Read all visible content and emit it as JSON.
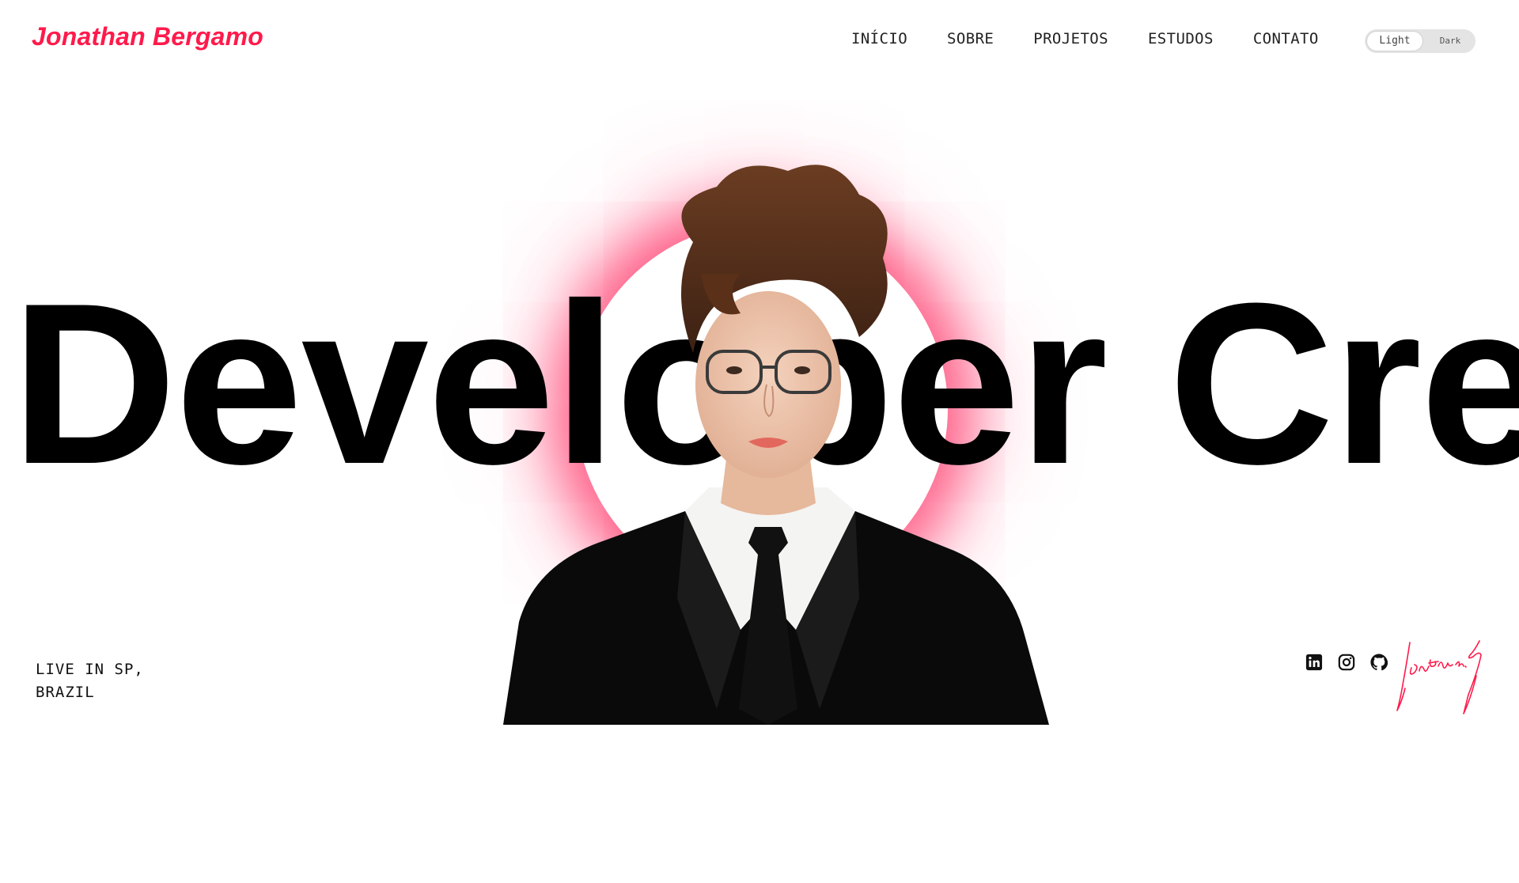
{
  "header": {
    "brand": "Jonathan Bergamo",
    "nav": [
      "INÍCIO",
      "SOBRE",
      "PROJETOS",
      "ESTUDOS",
      "CONTATO"
    ],
    "theme_toggle": {
      "light_label": "Light",
      "dark_label": "Dark",
      "selected": "Light"
    }
  },
  "hero": {
    "headline": "Developer Cre",
    "location_line1": "LIVE IN SP,",
    "location_line2": "BRAZIL"
  },
  "social_icons": [
    "linkedin-icon",
    "instagram-icon",
    "github-icon"
  ],
  "signature_text": "Jonathan.g",
  "colors": {
    "accent": "#ff1a4b",
    "text": "#000000",
    "background": "#ffffff",
    "glow": "#ff2d62"
  }
}
